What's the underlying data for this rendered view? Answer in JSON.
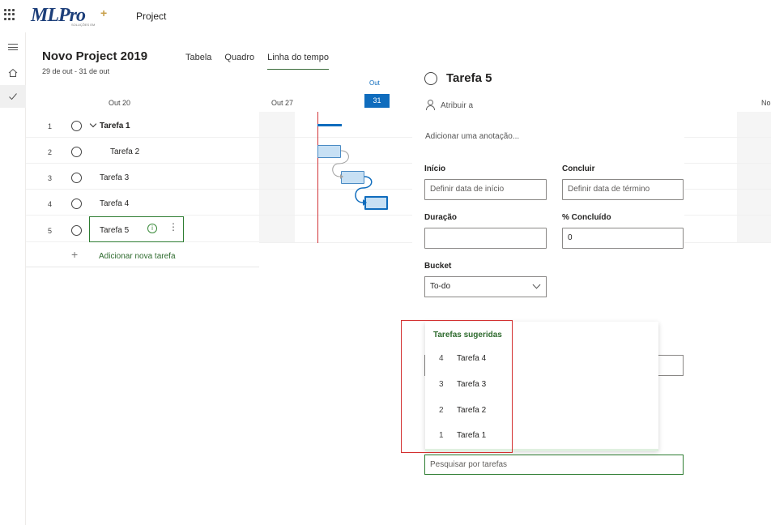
{
  "app": {
    "logo_main": "MLPro",
    "logo_sub": "SOLUÇÕES EM",
    "name": "Project"
  },
  "project": {
    "title": "Novo Project 2019",
    "dates": "29 de out - 31 de out"
  },
  "tabs": [
    {
      "label": "Tabela",
      "active": false
    },
    {
      "label": "Quadro",
      "active": false
    },
    {
      "label": "Linha do tempo",
      "active": true
    }
  ],
  "timeline": {
    "labels": [
      "Out 20",
      "Out 27"
    ],
    "month": "Out",
    "today": "31",
    "right_label": "No"
  },
  "tasks": [
    {
      "num": "1",
      "name": "Tarefa 1"
    },
    {
      "num": "2",
      "name": "Tarefa 2"
    },
    {
      "num": "3",
      "name": "Tarefa 3"
    },
    {
      "num": "4",
      "name": "Tarefa 4"
    },
    {
      "num": "5",
      "name": "Tarefa 5"
    }
  ],
  "add_task_label": "Adicionar nova tarefa",
  "details": {
    "title": "Tarefa 5",
    "assign": "Atribuir a",
    "note": "Adicionar uma anotação...",
    "start_label": "Início",
    "start_placeholder": "Definir data de início",
    "end_label": "Concluir",
    "end_placeholder": "Definir data de término",
    "duration_label": "Duração",
    "duration_value": "",
    "percent_label": "% Concluído",
    "percent_value": "0",
    "bucket_label": "Bucket",
    "bucket_value": "To-do",
    "search_placeholder": "Pesquisar por tarefas"
  },
  "suggestions": {
    "title": "Tarefas sugeridas",
    "items": [
      {
        "num": "4",
        "name": "Tarefa 4"
      },
      {
        "num": "3",
        "name": "Tarefa 3"
      },
      {
        "num": "2",
        "name": "Tarefa 2"
      },
      {
        "num": "1",
        "name": "Tarefa 1"
      }
    ]
  },
  "colors": {
    "accent_blue": "#0f6cbd",
    "accent_green": "#2e7d32",
    "today_red": "#d13438",
    "highlight_red": "#d32f2f"
  }
}
